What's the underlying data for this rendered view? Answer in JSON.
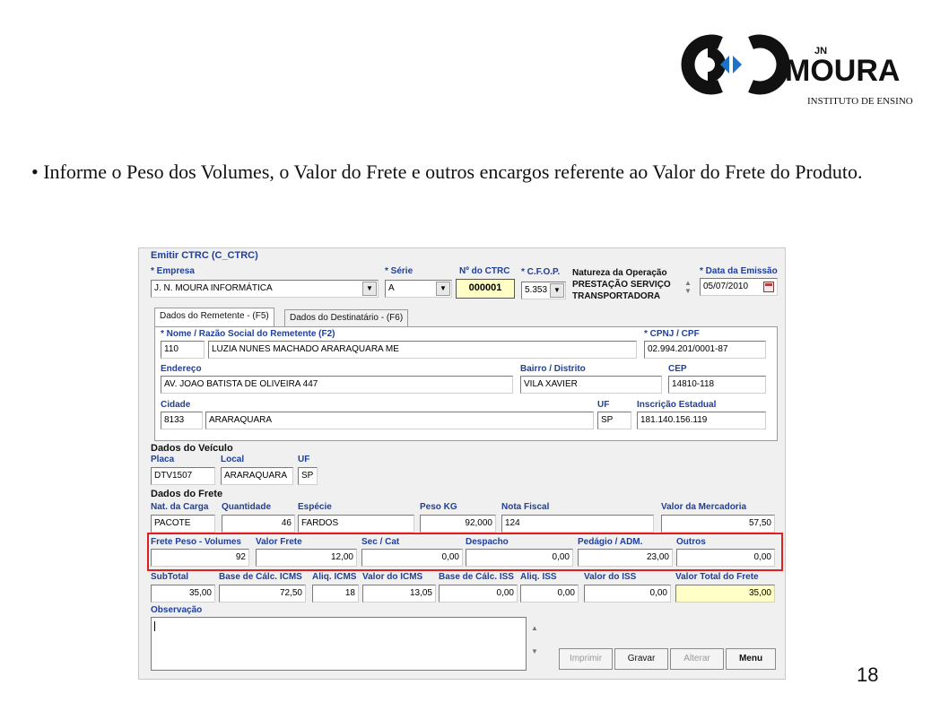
{
  "logo": {
    "brand": "MOURA",
    "superscript": "JN",
    "subtitle": "INSTITUTO DE ENSINO"
  },
  "slide": {
    "bullet": "•",
    "text": "Informe o Peso dos Volumes, o Valor do Frete e outros encargos referente ao Valor do Frete do Produto.",
    "page_number": "18"
  },
  "window": {
    "title": "Emitir CTRC (C_CTRC)",
    "header": {
      "empresa_label": "* Empresa",
      "empresa_value": "J. N. MOURA INFORMÁTICA",
      "serie_label": "* Série",
      "serie_value": "A",
      "ctrc_label": "Nº do CTRC",
      "ctrc_value": "000001",
      "cfop_label": "* C.F.O.P.",
      "cfop_value": "5.353",
      "natureza_label": "Natureza da Operação",
      "natureza_line1": "PRESTAÇÃO SERVIÇO",
      "natureza_line2": "TRANSPORTADORA",
      "data_label": "* Data da Emissão",
      "data_value": "05/07/2010"
    },
    "tabs": [
      {
        "label": "Dados do Remetente - (F5)"
      },
      {
        "label": "Dados do Destinatário - (F6)"
      }
    ],
    "remetente": {
      "nome_label": "* Nome / Razão Social do Remetente (F2)",
      "codigo": "110",
      "nome": "LUZIA NUNES MACHADO ARARAQUARA ME",
      "cnpj_label": "* CPNJ / CPF",
      "cnpj": "02.994.201/0001-87",
      "endereco_label": "Endereço",
      "endereco": "AV. JOAO BATISTA DE OLIVEIRA 447",
      "bairro_label": "Bairro / Distrito",
      "bairro": "VILA XAVIER",
      "cep_label": "CEP",
      "cep": "14810-118",
      "cidade_label": "Cidade",
      "cidade_codigo": "8133",
      "cidade": "ARARAQUARA",
      "uf_label": "UF",
      "uf": "SP",
      "ie_label": "Inscrição Estadual",
      "ie": "181.140.156.119"
    },
    "veiculo": {
      "section": "Dados do Veículo",
      "placa_label": "Placa",
      "placa": "DTV1507",
      "local_label": "Local",
      "local": "ARARAQUARA",
      "uf_label": "UF",
      "uf": "SP"
    },
    "frete": {
      "section": "Dados do Frete",
      "nat_label": "Nat. da Carga",
      "nat": "PACOTE",
      "quantidade_label": "Quantidade",
      "quantidade": "46",
      "especie_label": "Espécie",
      "especie": "FARDOS",
      "peso_label": "Peso KG",
      "peso": "92,000",
      "nota_label": "Nota Fiscal",
      "nota": "124",
      "valor_merc_label": "Valor da Mercadoria",
      "valor_merc": "57,50",
      "frete_peso_label": "Frete Peso - Volumes",
      "frete_peso": "92",
      "valor_frete_label": "Valor Frete",
      "valor_frete": "12,00",
      "sec_cat_label": "Sec / Cat",
      "sec_cat": "0,00",
      "despacho_label": "Despacho",
      "despacho": "0,00",
      "pedagio_label": "Pedágio / ADM.",
      "pedagio": "23,00",
      "outros_label": "Outros",
      "outros": "0,00",
      "subtotal_label": "SubTotal",
      "subtotal": "35,00",
      "base_icms_label": "Base de Cálc. ICMS",
      "base_icms": "72,50",
      "aliq_icms_label": "Aliq. ICMS",
      "aliq_icms": "18",
      "valor_icms_label": "Valor do ICMS",
      "valor_icms": "13,05",
      "base_iss_label": "Base de Cálc. ISS",
      "base_iss": "0,00",
      "aliq_iss_label": "Aliq. ISS",
      "aliq_iss": "0,00",
      "valor_iss_label": "Valor do ISS",
      "valor_iss": "0,00",
      "total_label": "Valor Total do Frete",
      "total": "35,00"
    },
    "observacao_label": "Observação",
    "buttons": {
      "imprimir": "Imprimir",
      "gravar": "Gravar",
      "alterar": "Alterar",
      "menu": "Menu"
    }
  },
  "colors": {
    "label_blue": "#1f3f99",
    "highlight_red": "#e02020",
    "total_yellow": "#ffffc6",
    "logo_blue": "#1e73c8"
  }
}
